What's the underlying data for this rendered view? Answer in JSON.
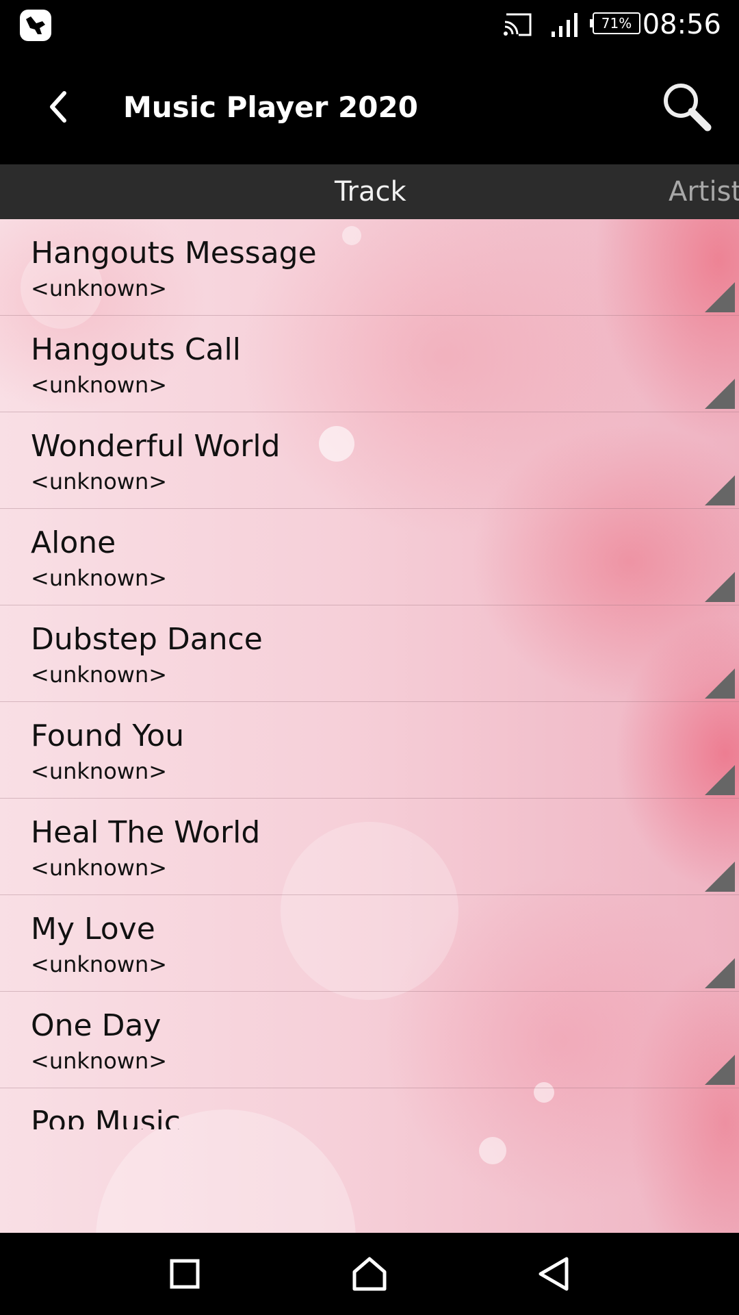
{
  "status_bar": {
    "app_icon": "bird-notification-icon",
    "cast_icon": "cast-icon",
    "signal_icon": "signal-icon",
    "battery_level": "71%",
    "time": "08:56"
  },
  "app_bar": {
    "back_icon": "chevron-left-icon",
    "title": "Music Player 2020",
    "search_icon": "search-icon"
  },
  "tabs": [
    {
      "label": "Track",
      "selected": true
    },
    {
      "label": "Artist",
      "selected": false
    }
  ],
  "tracks": [
    {
      "title": "Hangouts Message",
      "artist": "<unknown>"
    },
    {
      "title": "Hangouts Call",
      "artist": "<unknown>"
    },
    {
      "title": "Wonderful World",
      "artist": "<unknown>"
    },
    {
      "title": "Alone",
      "artist": "<unknown>"
    },
    {
      "title": "Dubstep Dance",
      "artist": "<unknown>"
    },
    {
      "title": "Found You",
      "artist": "<unknown>"
    },
    {
      "title": "Heal The World",
      "artist": "<unknown>"
    },
    {
      "title": "My Love",
      "artist": "<unknown>"
    },
    {
      "title": "One Day",
      "artist": "<unknown>"
    },
    {
      "title": "Pop Music",
      "artist": ""
    }
  ],
  "nav_bar": {
    "recents_icon": "square-icon",
    "home_icon": "home-icon",
    "back_icon": "triangle-back-icon"
  },
  "colors": {
    "bar_background": "#000000",
    "tab_bar_background": "#2c2c2c",
    "selected_tab_text": "#f2f2f2",
    "unselected_tab_text": "#a8a8a8",
    "list_background": "#f6d0d9",
    "accent_pink": "#eb5a6e",
    "row_text": "#111111"
  }
}
